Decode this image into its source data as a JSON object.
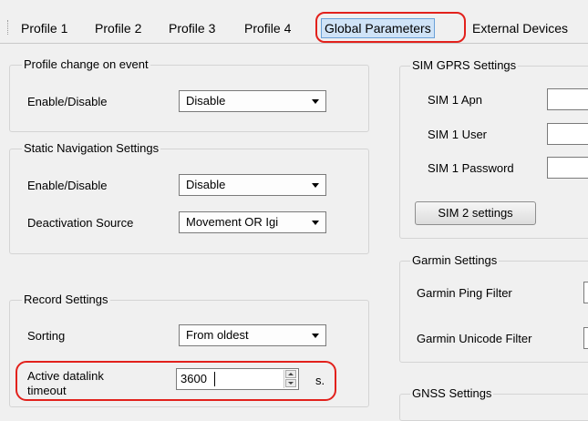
{
  "tabs": [
    {
      "label": "Profile 1"
    },
    {
      "label": "Profile 2"
    },
    {
      "label": "Profile 3"
    },
    {
      "label": "Profile 4"
    },
    {
      "label": "Global Parameters",
      "selected": true
    },
    {
      "label": "External Devices"
    }
  ],
  "profile_change": {
    "title": "Profile change on event",
    "enable_label": "Enable/Disable",
    "enable_value": "Disable"
  },
  "static_nav": {
    "title": "Static Navigation Settings",
    "enable_label": "Enable/Disable",
    "enable_value": "Disable",
    "deactivation_label": "Deactivation Source",
    "deactivation_value": "Movement OR Igi"
  },
  "record": {
    "title": "Record Settings",
    "sorting_label": "Sorting",
    "sorting_value": "From oldest",
    "timeout_label_line1": "Active datalink",
    "timeout_label_line2": "timeout",
    "timeout_value": "3600",
    "timeout_unit": "s."
  },
  "sim_gprs": {
    "title": "SIM GPRS Settings",
    "apn_label": "SIM 1 Apn",
    "user_label": "SIM 1 User",
    "password_label": "SIM 1 Password",
    "sim2_button": "SIM 2 settings"
  },
  "garmin": {
    "title": "Garmin Settings",
    "ping_label": "Garmin Ping Filter",
    "unicode_label": "Garmin Unicode Filter"
  },
  "gnss": {
    "title": "GNSS Settings"
  },
  "colors": {
    "highlight": "#e2211c",
    "selected_tab": "#cfe3f7"
  }
}
